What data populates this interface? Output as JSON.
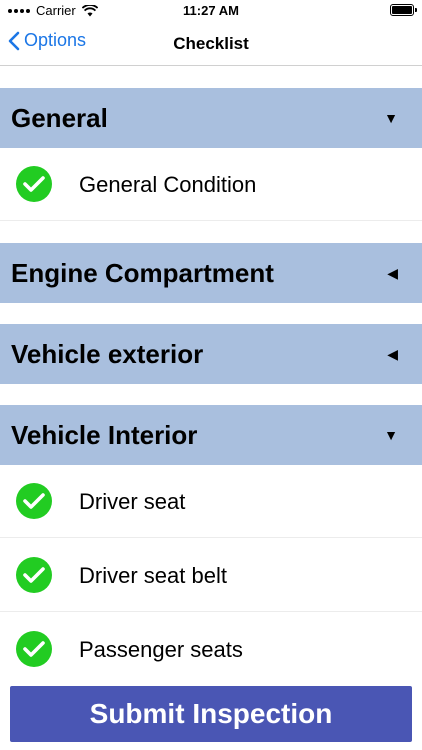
{
  "status_bar": {
    "carrier": "Carrier",
    "time": "11:27 AM",
    "icons": [
      "signal-icon",
      "wifi-icon",
      "battery-icon"
    ]
  },
  "nav": {
    "back_label": "Options",
    "title": "Checklist"
  },
  "sections": [
    {
      "title": "General",
      "expanded": true,
      "arrow": "▼",
      "items": [
        {
          "label": "General Condition",
          "checked": true
        }
      ]
    },
    {
      "title": "Engine Compartment",
      "expanded": false,
      "arrow": "◀",
      "items": []
    },
    {
      "title": "Vehicle exterior",
      "expanded": false,
      "arrow": "◀",
      "items": []
    },
    {
      "title": "Vehicle Interior",
      "expanded": true,
      "arrow": "▼",
      "items": [
        {
          "label": "Driver seat",
          "checked": true
        },
        {
          "label": "Driver seat belt",
          "checked": true
        },
        {
          "label": "Passenger seats",
          "checked": true
        }
      ]
    }
  ],
  "submit_label": "Submit Inspection",
  "colors": {
    "accent": "#1b76e6",
    "section_header": "#a9bfde",
    "check": "#22cc22",
    "submit": "#4a56b4"
  }
}
